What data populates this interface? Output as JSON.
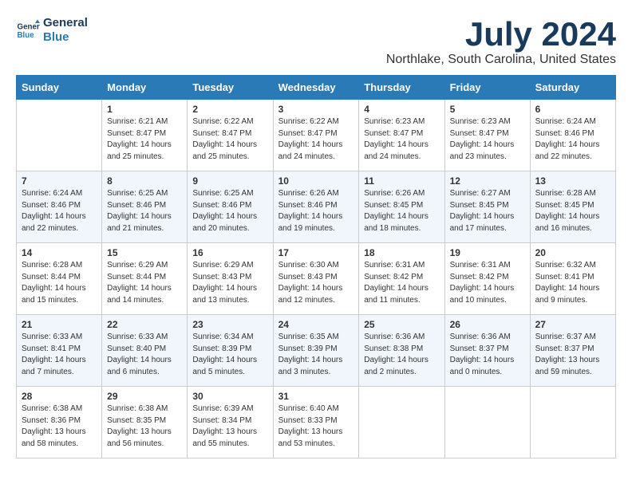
{
  "header": {
    "logo_line1": "General",
    "logo_line2": "Blue",
    "month": "July 2024",
    "location": "Northlake, South Carolina, United States"
  },
  "days_of_week": [
    "Sunday",
    "Monday",
    "Tuesday",
    "Wednesday",
    "Thursday",
    "Friday",
    "Saturday"
  ],
  "weeks": [
    [
      {
        "day": "",
        "info": ""
      },
      {
        "day": "1",
        "info": "Sunrise: 6:21 AM\nSunset: 8:47 PM\nDaylight: 14 hours\nand 25 minutes."
      },
      {
        "day": "2",
        "info": "Sunrise: 6:22 AM\nSunset: 8:47 PM\nDaylight: 14 hours\nand 25 minutes."
      },
      {
        "day": "3",
        "info": "Sunrise: 6:22 AM\nSunset: 8:47 PM\nDaylight: 14 hours\nand 24 minutes."
      },
      {
        "day": "4",
        "info": "Sunrise: 6:23 AM\nSunset: 8:47 PM\nDaylight: 14 hours\nand 24 minutes."
      },
      {
        "day": "5",
        "info": "Sunrise: 6:23 AM\nSunset: 8:47 PM\nDaylight: 14 hours\nand 23 minutes."
      },
      {
        "day": "6",
        "info": "Sunrise: 6:24 AM\nSunset: 8:46 PM\nDaylight: 14 hours\nand 22 minutes."
      }
    ],
    [
      {
        "day": "7",
        "info": "Sunrise: 6:24 AM\nSunset: 8:46 PM\nDaylight: 14 hours\nand 22 minutes."
      },
      {
        "day": "8",
        "info": "Sunrise: 6:25 AM\nSunset: 8:46 PM\nDaylight: 14 hours\nand 21 minutes."
      },
      {
        "day": "9",
        "info": "Sunrise: 6:25 AM\nSunset: 8:46 PM\nDaylight: 14 hours\nand 20 minutes."
      },
      {
        "day": "10",
        "info": "Sunrise: 6:26 AM\nSunset: 8:46 PM\nDaylight: 14 hours\nand 19 minutes."
      },
      {
        "day": "11",
        "info": "Sunrise: 6:26 AM\nSunset: 8:45 PM\nDaylight: 14 hours\nand 18 minutes."
      },
      {
        "day": "12",
        "info": "Sunrise: 6:27 AM\nSunset: 8:45 PM\nDaylight: 14 hours\nand 17 minutes."
      },
      {
        "day": "13",
        "info": "Sunrise: 6:28 AM\nSunset: 8:45 PM\nDaylight: 14 hours\nand 16 minutes."
      }
    ],
    [
      {
        "day": "14",
        "info": "Sunrise: 6:28 AM\nSunset: 8:44 PM\nDaylight: 14 hours\nand 15 minutes."
      },
      {
        "day": "15",
        "info": "Sunrise: 6:29 AM\nSunset: 8:44 PM\nDaylight: 14 hours\nand 14 minutes."
      },
      {
        "day": "16",
        "info": "Sunrise: 6:29 AM\nSunset: 8:43 PM\nDaylight: 14 hours\nand 13 minutes."
      },
      {
        "day": "17",
        "info": "Sunrise: 6:30 AM\nSunset: 8:43 PM\nDaylight: 14 hours\nand 12 minutes."
      },
      {
        "day": "18",
        "info": "Sunrise: 6:31 AM\nSunset: 8:42 PM\nDaylight: 14 hours\nand 11 minutes."
      },
      {
        "day": "19",
        "info": "Sunrise: 6:31 AM\nSunset: 8:42 PM\nDaylight: 14 hours\nand 10 minutes."
      },
      {
        "day": "20",
        "info": "Sunrise: 6:32 AM\nSunset: 8:41 PM\nDaylight: 14 hours\nand 9 minutes."
      }
    ],
    [
      {
        "day": "21",
        "info": "Sunrise: 6:33 AM\nSunset: 8:41 PM\nDaylight: 14 hours\nand 7 minutes."
      },
      {
        "day": "22",
        "info": "Sunrise: 6:33 AM\nSunset: 8:40 PM\nDaylight: 14 hours\nand 6 minutes."
      },
      {
        "day": "23",
        "info": "Sunrise: 6:34 AM\nSunset: 8:39 PM\nDaylight: 14 hours\nand 5 minutes."
      },
      {
        "day": "24",
        "info": "Sunrise: 6:35 AM\nSunset: 8:39 PM\nDaylight: 14 hours\nand 3 minutes."
      },
      {
        "day": "25",
        "info": "Sunrise: 6:36 AM\nSunset: 8:38 PM\nDaylight: 14 hours\nand 2 minutes."
      },
      {
        "day": "26",
        "info": "Sunrise: 6:36 AM\nSunset: 8:37 PM\nDaylight: 14 hours\nand 0 minutes."
      },
      {
        "day": "27",
        "info": "Sunrise: 6:37 AM\nSunset: 8:37 PM\nDaylight: 13 hours\nand 59 minutes."
      }
    ],
    [
      {
        "day": "28",
        "info": "Sunrise: 6:38 AM\nSunset: 8:36 PM\nDaylight: 13 hours\nand 58 minutes."
      },
      {
        "day": "29",
        "info": "Sunrise: 6:38 AM\nSunset: 8:35 PM\nDaylight: 13 hours\nand 56 minutes."
      },
      {
        "day": "30",
        "info": "Sunrise: 6:39 AM\nSunset: 8:34 PM\nDaylight: 13 hours\nand 55 minutes."
      },
      {
        "day": "31",
        "info": "Sunrise: 6:40 AM\nSunset: 8:33 PM\nDaylight: 13 hours\nand 53 minutes."
      },
      {
        "day": "",
        "info": ""
      },
      {
        "day": "",
        "info": ""
      },
      {
        "day": "",
        "info": ""
      }
    ]
  ]
}
